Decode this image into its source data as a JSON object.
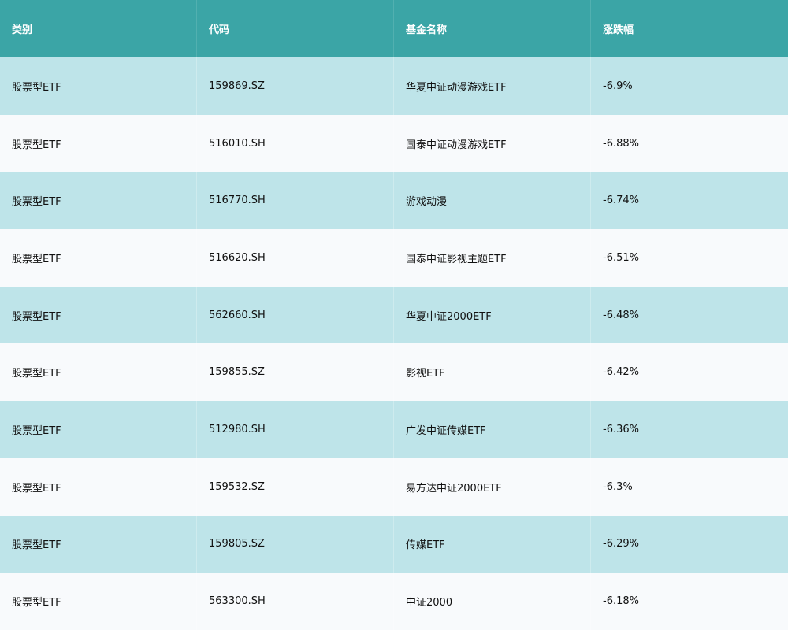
{
  "table": {
    "headers": [
      "类别",
      "代码",
      "基金名称",
      "涨跌幅"
    ],
    "rows": [
      [
        "股票型ETF",
        "159869.SZ",
        "华夏中证动漫游戏ETF",
        "-6.9%"
      ],
      [
        "股票型ETF",
        "516010.SH",
        "国泰中证动漫游戏ETF",
        "-6.88%"
      ],
      [
        "股票型ETF",
        "516770.SH",
        "游戏动漫",
        "-6.74%"
      ],
      [
        "股票型ETF",
        "516620.SH",
        "国泰中证影视主题ETF",
        "-6.51%"
      ],
      [
        "股票型ETF",
        "562660.SH",
        "华夏中证2000ETF",
        "-6.48%"
      ],
      [
        "股票型ETF",
        "159855.SZ",
        "影视ETF",
        "-6.42%"
      ],
      [
        "股票型ETF",
        "512980.SH",
        "广发中证传媒ETF",
        "-6.36%"
      ],
      [
        "股票型ETF",
        "159532.SZ",
        "易方达中证2000ETF",
        "-6.3%"
      ],
      [
        "股票型ETF",
        "159805.SZ",
        "传媒ETF",
        "-6.29%"
      ],
      [
        "股票型ETF",
        "563300.SH",
        "中证2000",
        "-6.18%"
      ]
    ]
  },
  "colors": {
    "header_bg": "#3ba5a6",
    "row_odd_bg": "#bee4e9",
    "row_even_bg": "#f8fafc"
  }
}
